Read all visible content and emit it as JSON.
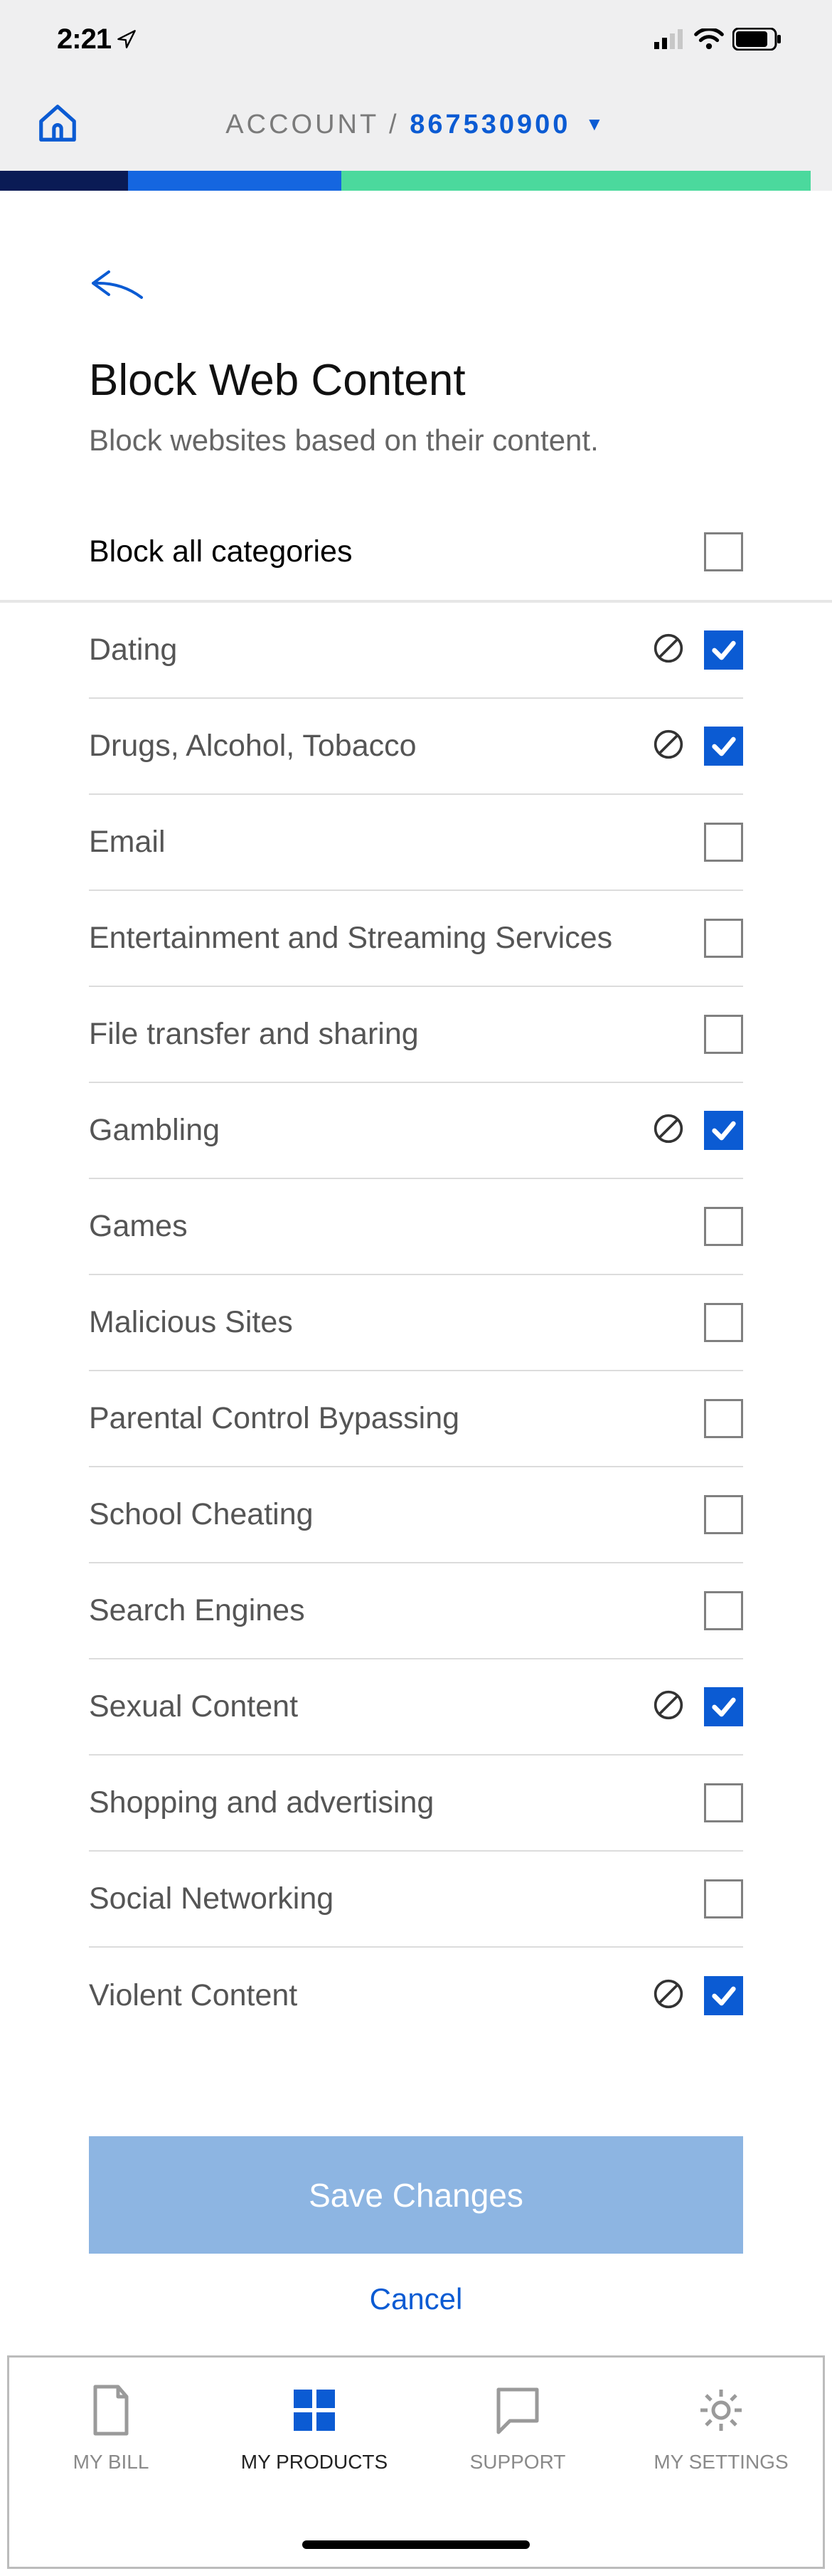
{
  "status": {
    "time": "2:21"
  },
  "header": {
    "account_label": "ACCOUNT /",
    "account_number": "867530900"
  },
  "page": {
    "title": "Block Web Content",
    "subtitle": "Block websites based on their content.",
    "block_all_label": "Block all categories",
    "block_all_checked": false
  },
  "categories": [
    {
      "label": "Dating",
      "checked": true,
      "has_block_icon": true
    },
    {
      "label": "Drugs, Alcohol, Tobacco",
      "checked": true,
      "has_block_icon": true
    },
    {
      "label": "Email",
      "checked": false,
      "has_block_icon": false
    },
    {
      "label": "Entertainment and Streaming Services",
      "checked": false,
      "has_block_icon": false
    },
    {
      "label": "File transfer and sharing",
      "checked": false,
      "has_block_icon": false
    },
    {
      "label": "Gambling",
      "checked": true,
      "has_block_icon": true
    },
    {
      "label": "Games",
      "checked": false,
      "has_block_icon": false
    },
    {
      "label": "Malicious Sites",
      "checked": false,
      "has_block_icon": false
    },
    {
      "label": "Parental Control Bypassing",
      "checked": false,
      "has_block_icon": false
    },
    {
      "label": "School Cheating",
      "checked": false,
      "has_block_icon": false
    },
    {
      "label": "Search Engines",
      "checked": false,
      "has_block_icon": false
    },
    {
      "label": "Sexual Content",
      "checked": true,
      "has_block_icon": true
    },
    {
      "label": "Shopping and advertising",
      "checked": false,
      "has_block_icon": false
    },
    {
      "label": "Social Networking",
      "checked": false,
      "has_block_icon": false
    },
    {
      "label": "Violent Content",
      "checked": true,
      "has_block_icon": true
    }
  ],
  "buttons": {
    "save": "Save Changes",
    "cancel": "Cancel"
  },
  "nav": {
    "items": [
      {
        "label": "MY BILL"
      },
      {
        "label": "MY PRODUCTS"
      },
      {
        "label": "SUPPORT"
      },
      {
        "label": "MY SETTINGS"
      }
    ]
  }
}
